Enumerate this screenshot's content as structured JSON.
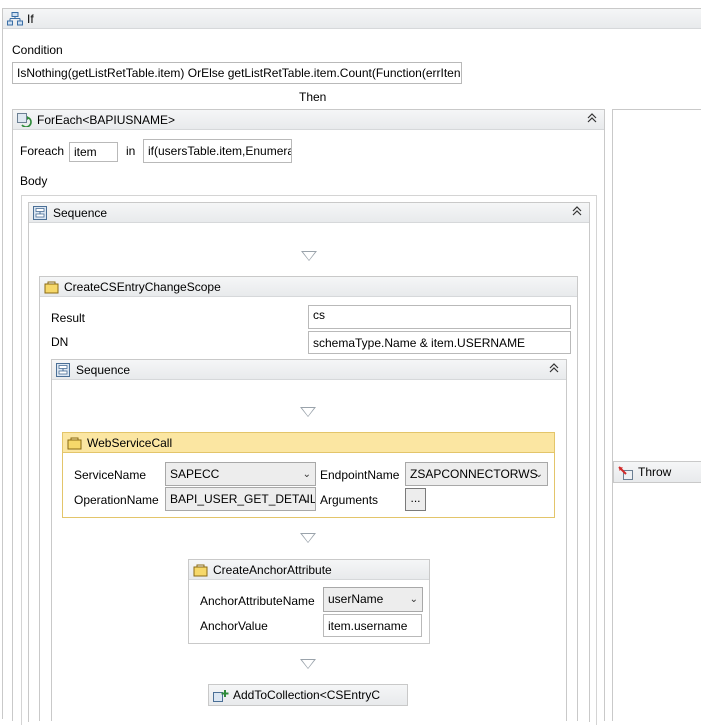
{
  "if_activity": {
    "title": "If"
  },
  "condition": {
    "label": "Condition",
    "value": "IsNothing(getListRetTable.item) OrElse  getListRetTable.item.Count(Function(errIten"
  },
  "then_label": "Then",
  "foreach": {
    "title": "ForEach<BAPIUSNAME>",
    "foreach_label": "Foreach",
    "item_value": "item",
    "in_label": "in",
    "collection_value": "if(usersTable.item,Enumera",
    "body_label": "Body",
    "collapse_glyph": "⌃"
  },
  "sequence_outer": {
    "title": "Sequence"
  },
  "create_cs_entry": {
    "title": "CreateCSEntryChangeScope",
    "result_label": "Result",
    "result_value": "cs",
    "dn_label": "DN",
    "dn_value": "schemaType.Name & item.USERNAME"
  },
  "sequence_inner": {
    "title": "Sequence"
  },
  "web_service_call": {
    "title": "WebServiceCall",
    "service_name_label": "ServiceName",
    "service_name_value": "SAPECC",
    "endpoint_name_label": "EndpointName",
    "endpoint_name_value": "ZSAPCONNECTORWS",
    "operation_name_label": "OperationName",
    "operation_name_value": "BAPI_USER_GET_DETAIL",
    "arguments_label": "Arguments",
    "arguments_button": "..."
  },
  "create_anchor": {
    "title": "CreateAnchorAttribute",
    "anchor_attr_name_label": "AnchorAttributeName",
    "anchor_attr_name_value": "userName",
    "anchor_value_label": "AnchorValue",
    "anchor_value_value": "item.username"
  },
  "add_to_collection": {
    "title": "AddToCollection<CSEntryC"
  },
  "throw_activity": {
    "title": "Throw"
  },
  "colors": {
    "header_bg": "#e8eaec",
    "yellow_header": "#fbe6a2",
    "yellow_border": "#e3c56a",
    "border": "#c9c9c9"
  }
}
